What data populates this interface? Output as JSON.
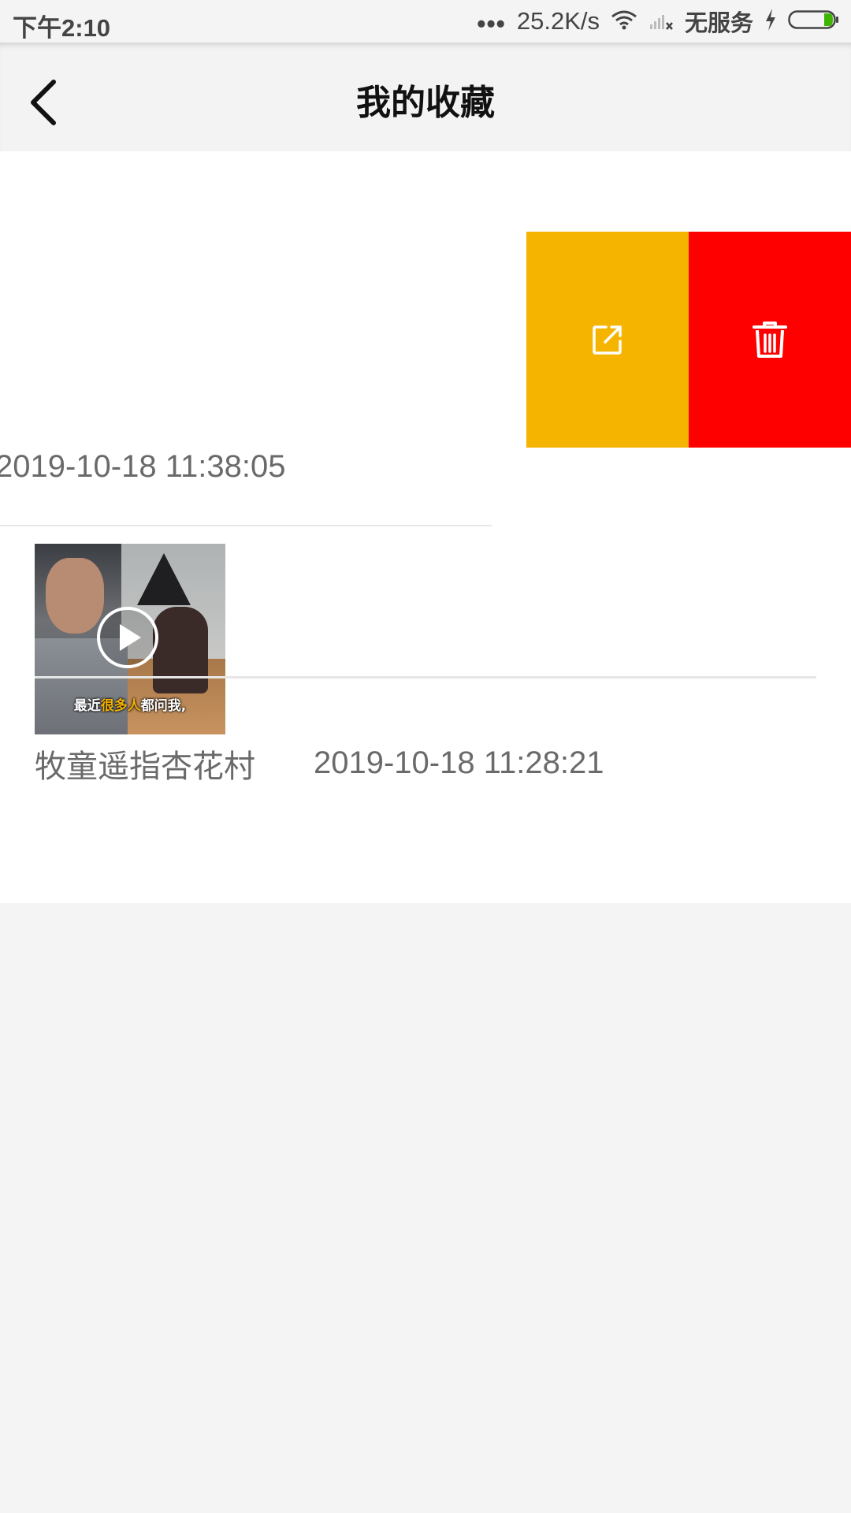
{
  "status_bar": {
    "time": "下午2:10",
    "dots": "•••",
    "net_speed": "25.2K/s",
    "carrier": "无服务",
    "icons": [
      "wifi-icon",
      "signal-icon",
      "charging-icon",
      "battery-icon"
    ]
  },
  "header": {
    "title": "我的收藏",
    "back_icon": "chevron-left-icon"
  },
  "favorites": [
    {
      "date": "2019-10-18 11:38:05",
      "swipe_actions": [
        {
          "icon": "share-icon",
          "color": "#f5b400"
        },
        {
          "icon": "trash-icon",
          "color": "#ff0000"
        }
      ]
    },
    {
      "title": "牧童遥指杏花村",
      "date": "2019-10-18 11:28:21",
      "thumbnail": {
        "caption_pre": "最近",
        "caption_highlight": "很多人",
        "caption_post": "都问我,",
        "icon": "play-icon"
      }
    }
  ],
  "colors": {
    "accent_yellow": "#f5b400",
    "delete_red": "#ff0000",
    "background": "#f4f4f4",
    "text_gray": "#6a6a6a"
  }
}
